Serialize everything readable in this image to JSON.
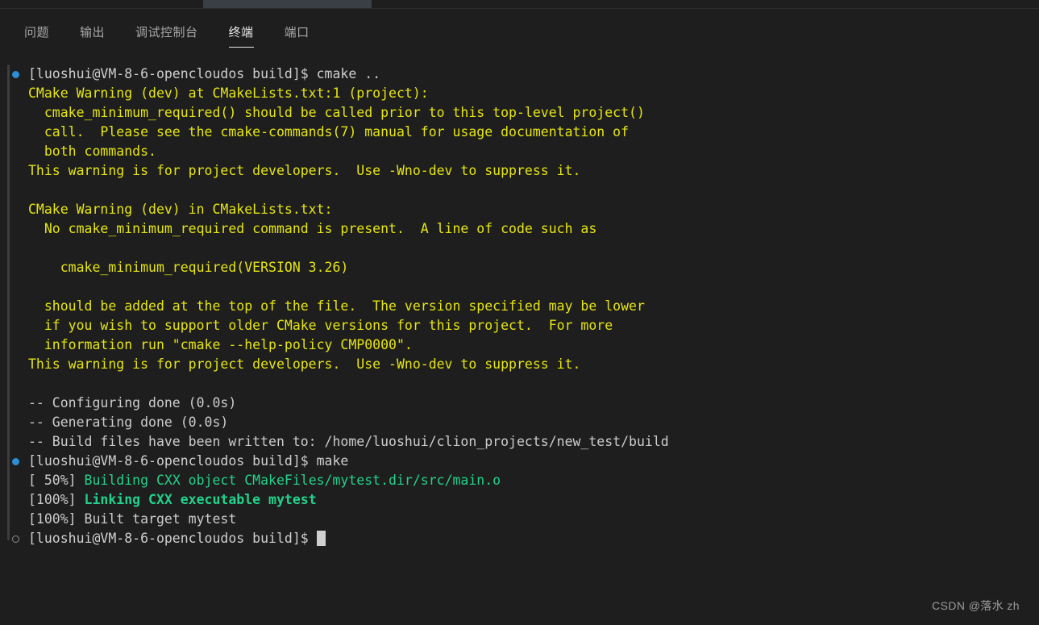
{
  "window": {
    "background": "#1e1e1e",
    "editor_tab_strip_visible": true
  },
  "panel": {
    "tabs": [
      {
        "label": "问题",
        "active": false
      },
      {
        "label": "输出",
        "active": false
      },
      {
        "label": "调试控制台",
        "active": false
      },
      {
        "label": "终端",
        "active": true
      },
      {
        "label": "端口",
        "active": false
      }
    ]
  },
  "colors": {
    "background": "#1e1e1e",
    "prompt": "#cfcfcf",
    "warning": "#e5e510",
    "success": "#23d18b",
    "accent_dot": "#2c8fd6",
    "inactive_dot": "#8a8a8a",
    "tab_active": "#e7e7e7",
    "tab_inactive": "#a9a9a9"
  },
  "terminal": {
    "prompt_text": "[luoshui@VM-8-6-opencloudos build]$ ",
    "cursor_visible": true,
    "lines": [
      {
        "marker": "filled",
        "segments": [
          {
            "text": "[luoshui@VM-8-6-opencloudos build]$ cmake ..",
            "style": "prompt"
          }
        ]
      },
      {
        "marker": "none",
        "segments": [
          {
            "text": "CMake Warning (dev) at CMakeLists.txt:1 (project):",
            "style": "warn"
          }
        ]
      },
      {
        "marker": "none",
        "segments": [
          {
            "text": "  cmake_minimum_required() should be called prior to this top-level project()",
            "style": "warn"
          }
        ]
      },
      {
        "marker": "none",
        "segments": [
          {
            "text": "  call.  Please see the cmake-commands(7) manual for usage documentation of",
            "style": "warn"
          }
        ]
      },
      {
        "marker": "none",
        "segments": [
          {
            "text": "  both commands.",
            "style": "warn"
          }
        ]
      },
      {
        "marker": "none",
        "segments": [
          {
            "text": "This warning is for project developers.  Use -Wno-dev to suppress it.",
            "style": "warn"
          }
        ]
      },
      {
        "marker": "none",
        "segments": [
          {
            "text": "",
            "style": "warn"
          }
        ]
      },
      {
        "marker": "none",
        "segments": [
          {
            "text": "CMake Warning (dev) in CMakeLists.txt:",
            "style": "warn"
          }
        ]
      },
      {
        "marker": "none",
        "segments": [
          {
            "text": "  No cmake_minimum_required command is present.  A line of code such as",
            "style": "warn"
          }
        ]
      },
      {
        "marker": "none",
        "segments": [
          {
            "text": "",
            "style": "warn"
          }
        ]
      },
      {
        "marker": "none",
        "segments": [
          {
            "text": "    cmake_minimum_required(VERSION 3.26)",
            "style": "warn"
          }
        ]
      },
      {
        "marker": "none",
        "segments": [
          {
            "text": "",
            "style": "warn"
          }
        ]
      },
      {
        "marker": "none",
        "segments": [
          {
            "text": "  should be added at the top of the file.  The version specified may be lower",
            "style": "warn"
          }
        ]
      },
      {
        "marker": "none",
        "segments": [
          {
            "text": "  if you wish to support older CMake versions for this project.  For more",
            "style": "warn"
          }
        ]
      },
      {
        "marker": "none",
        "segments": [
          {
            "text": "  information run \"cmake --help-policy CMP0000\".",
            "style": "warn"
          }
        ]
      },
      {
        "marker": "none",
        "segments": [
          {
            "text": "This warning is for project developers.  Use -Wno-dev to suppress it.",
            "style": "warn"
          }
        ]
      },
      {
        "marker": "none",
        "segments": [
          {
            "text": "",
            "style": "warn"
          }
        ]
      },
      {
        "marker": "none",
        "segments": [
          {
            "text": "-- Configuring done (0.0s)",
            "style": "white"
          }
        ]
      },
      {
        "marker": "none",
        "segments": [
          {
            "text": "-- Generating done (0.0s)",
            "style": "white"
          }
        ]
      },
      {
        "marker": "none",
        "segments": [
          {
            "text": "-- Build files have been written to: /home/luoshui/clion_projects/new_test/build",
            "style": "white"
          }
        ]
      },
      {
        "marker": "filled",
        "segments": [
          {
            "text": "[luoshui@VM-8-6-opencloudos build]$ make",
            "style": "prompt"
          }
        ]
      },
      {
        "marker": "none",
        "segments": [
          {
            "text": "[ 50%] ",
            "style": "white"
          },
          {
            "text": "Building CXX object CMakeFiles/mytest.dir/src/main.o",
            "style": "green"
          }
        ]
      },
      {
        "marker": "none",
        "segments": [
          {
            "text": "[100%] ",
            "style": "white"
          },
          {
            "text": "Linking CXX executable mytest",
            "style": "green-bold"
          }
        ]
      },
      {
        "marker": "none",
        "segments": [
          {
            "text": "[100%] Built target mytest",
            "style": "white"
          }
        ]
      },
      {
        "marker": "hollow",
        "segments": [
          {
            "text": "[luoshui@VM-8-6-opencloudos build]$ ",
            "style": "prompt"
          }
        ],
        "cursor": true
      }
    ]
  },
  "watermark": {
    "text": "CSDN @落水 zh"
  }
}
